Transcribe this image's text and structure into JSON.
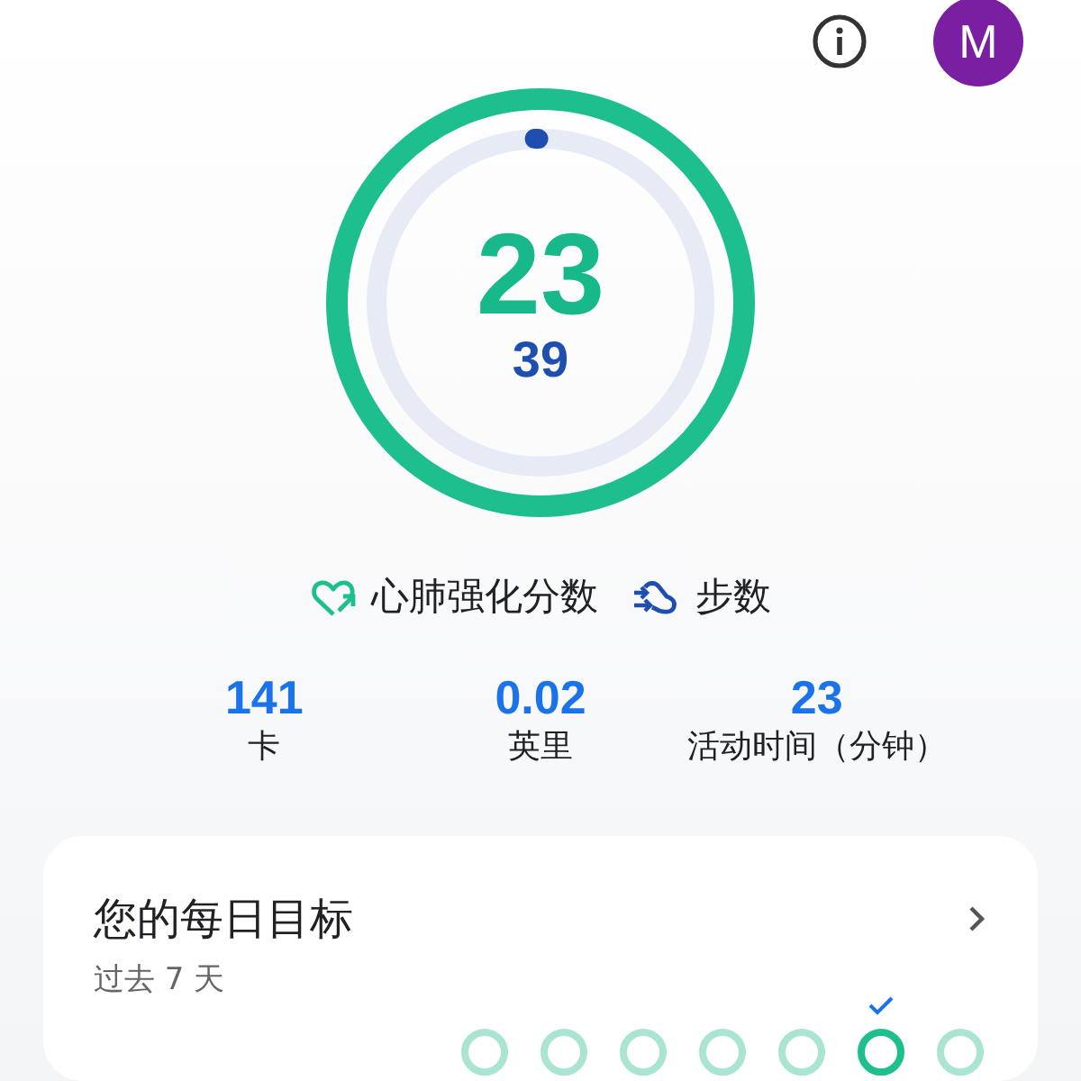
{
  "header": {
    "avatar": "M"
  },
  "rings": {
    "heart_points": {
      "value": "23"
    },
    "steps": {
      "value": "39"
    }
  },
  "legend": [
    {
      "kind": "heart",
      "label": "心肺强化分数"
    },
    {
      "kind": "steps",
      "label": "步数"
    }
  ],
  "stats": [
    {
      "value": "141",
      "label": "卡"
    },
    {
      "value": "0.02",
      "label": "英里"
    },
    {
      "value": "23",
      "label": "活动时间（分钟）"
    }
  ],
  "goals_card": {
    "title": "您的每日目标",
    "subtitle": "过去 7 天",
    "days": [
      {
        "achieved": false
      },
      {
        "achieved": false
      },
      {
        "achieved": false
      },
      {
        "achieved": false
      },
      {
        "achieved": false
      },
      {
        "achieved": true
      },
      {
        "achieved": false
      }
    ]
  }
}
